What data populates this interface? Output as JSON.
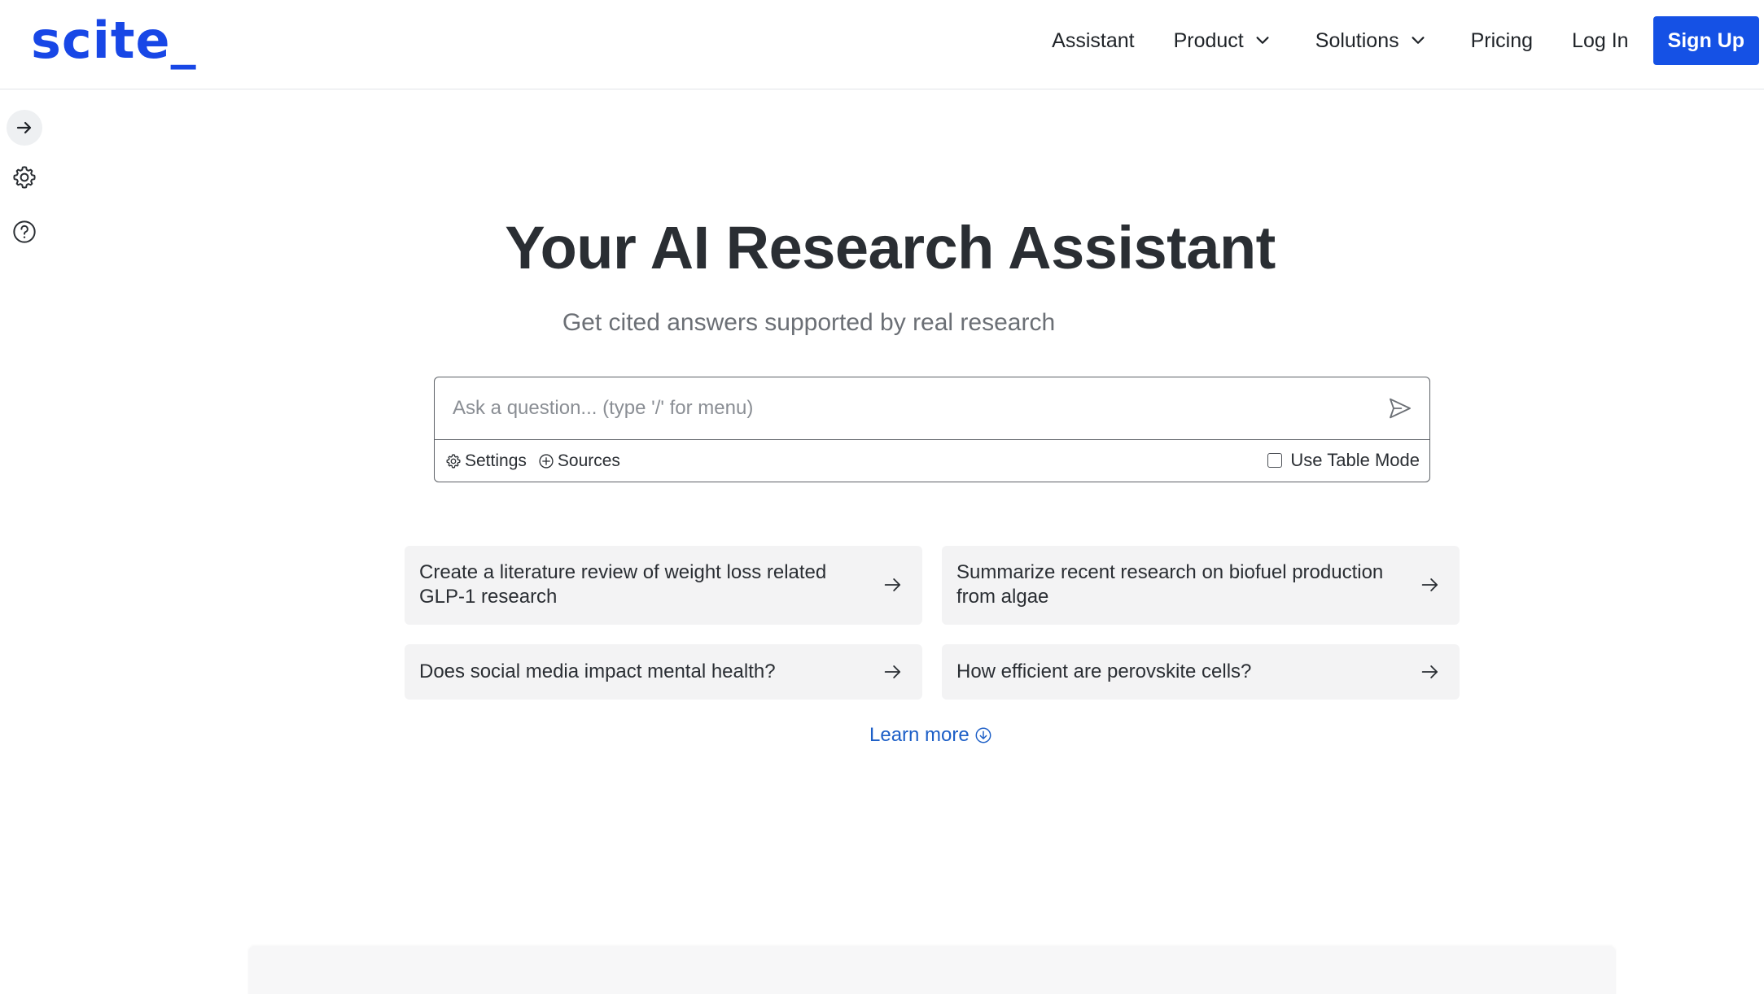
{
  "header": {
    "logo": "scite_",
    "nav": {
      "assistant": "Assistant",
      "product": "Product",
      "solutions": "Solutions",
      "pricing": "Pricing",
      "login": "Log In",
      "signup": "Sign Up"
    }
  },
  "sidebar": {
    "icons": [
      "arrow-right-icon",
      "gear-icon",
      "help-circle-icon"
    ]
  },
  "hero": {
    "title": "Your AI Research Assistant",
    "subtitle": "Get cited answers supported by real research"
  },
  "search": {
    "placeholder": "Ask a question... (type '/' for menu)",
    "value": "",
    "settings_label": "Settings",
    "sources_label": "Sources",
    "table_mode_label": "Use Table Mode",
    "table_mode_checked": false
  },
  "suggestions": [
    {
      "text": "Create a literature review of weight loss related GLP-1 research"
    },
    {
      "text": "Summarize recent research on biofuel production from algae"
    },
    {
      "text": "Does social media impact mental health?"
    },
    {
      "text": "How efficient are perovskite cells?"
    }
  ],
  "learn_more": "Learn more",
  "colors": {
    "brand": "#1847e6",
    "signup_bg": "#1551e5",
    "link": "#1d5fc7",
    "card_bg": "#f3f3f4"
  }
}
